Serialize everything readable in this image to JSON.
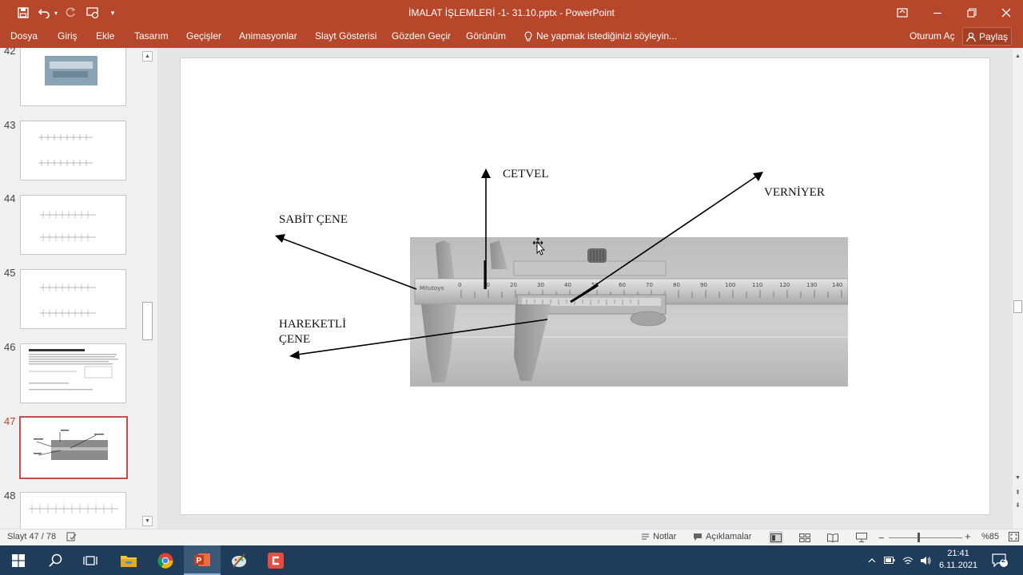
{
  "app": {
    "document_title": "İMALAT İŞLEMLERİ -1- 31.10.pptx - PowerPoint",
    "accent_color": "#b7472a"
  },
  "quick_access": {
    "icons": [
      "save-icon",
      "undo-icon",
      "undo-dropdown-icon",
      "redo-icon",
      "touch-mode-icon",
      "customize-icon"
    ]
  },
  "ribbon": {
    "tabs": [
      "Dosya",
      "Giriş",
      "Ekle",
      "Tasarım",
      "Geçişler",
      "Animasyonlar",
      "Slayt Gösterisi",
      "Gözden Geçir",
      "Görünüm"
    ],
    "tell_me": "Ne yapmak istediğinizi söyleyin...",
    "sign_in": "Oturum Aç",
    "share": "Paylaş"
  },
  "thumbnails": [
    {
      "number": "42",
      "active": false
    },
    {
      "number": "43",
      "active": false
    },
    {
      "number": "44",
      "active": false
    },
    {
      "number": "45",
      "active": false
    },
    {
      "number": "46",
      "active": false
    },
    {
      "number": "47",
      "active": true
    },
    {
      "number": "48",
      "active": false
    }
  ],
  "slide": {
    "labels": {
      "cetvel": "CETVEL",
      "verniyer": "VERNİYER",
      "sabit_cene": "SABİT ÇENE",
      "hareketli_1": "HAREKETLİ",
      "hareketli_2": "ÇENE"
    },
    "photo_scale_numbers": [
      "0",
      "10",
      "20",
      "30",
      "40",
      "50",
      "60",
      "70",
      "80",
      "90",
      "100",
      "110",
      "120",
      "130",
      "140"
    ],
    "brand": "Mitutoyo"
  },
  "status": {
    "slide_counter": "Slayt 47 / 78",
    "notes": "Notlar",
    "comments": "Açıklamalar",
    "zoom": "%85"
  },
  "taskbar": {
    "time": "21:41",
    "date": "6.11.2021",
    "notification_count": "2"
  }
}
